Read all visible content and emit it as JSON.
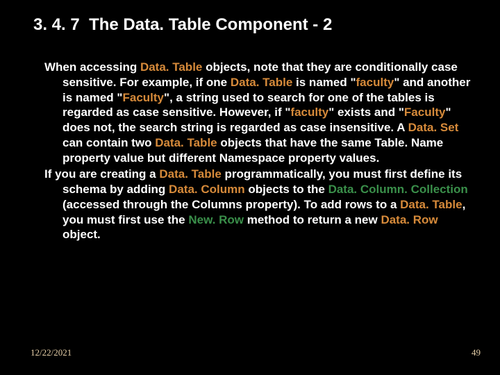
{
  "title": {
    "section": "3. 4. 7",
    "text": "The Data. Table Component - 2"
  },
  "body": {
    "p1": {
      "s1a": "When accessing ",
      "s1b": "Data. Table",
      "s1c": " objects, note that they are conditionally case sensitive. For example, if one ",
      "s1d": "Data. Table",
      "s1e": " is named \"",
      "s1f": "faculty",
      "s1g": "\" and another is named \"",
      "s1h": "Faculty",
      "s1i": "\", a string used to search for one of the tables is regarded as case sensitive. However, if \"",
      "s1j": "faculty",
      "s1k": "\" exists and \"",
      "s1l": "Faculty",
      "s1m": "\" does not, the search string is regarded as case insensitive. A ",
      "s1n": "Data. Set",
      "s1o": " can contain two ",
      "s1p": "Data. Table",
      "s1q": " objects that have the same Table. Name property value but different Namespace property values."
    },
    "p2": {
      "s2a": "If you are creating a ",
      "s2b": "Data. Table",
      "s2c": " programmatically, you must first define its schema by adding ",
      "s2d": "Data. Column",
      "s2e": " objects to the ",
      "s2f": "Data. Column. Collection",
      "s2g": " (accessed through the Columns property). To add rows to a ",
      "s2h": "Data. Table",
      "s2i": ", you must first use the ",
      "s2j": "New. Row",
      "s2k": " method to return a new ",
      "s2l": "Data. Row",
      "s2m": " object."
    }
  },
  "footer": {
    "date": "12/22/2021",
    "page": "49"
  }
}
